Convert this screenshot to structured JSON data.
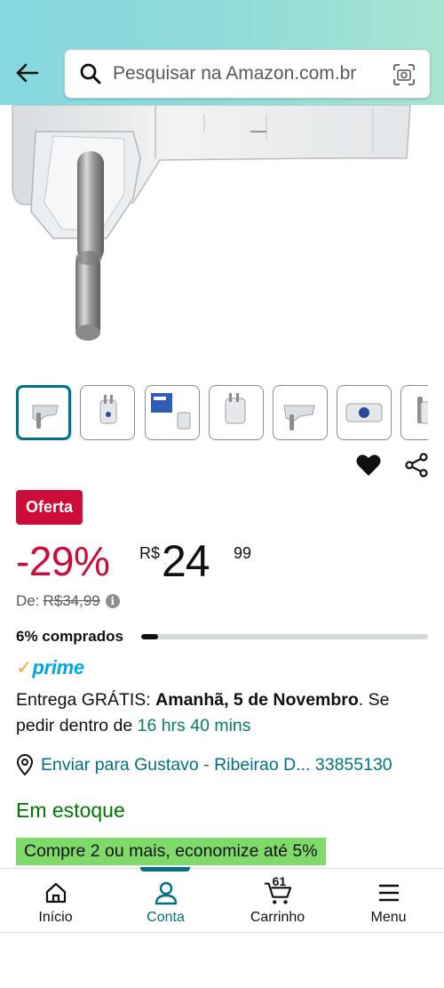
{
  "search": {
    "placeholder": "Pesquisar na Amazon.com.br"
  },
  "deal": {
    "badge": "Oferta"
  },
  "price": {
    "discount": "-29%",
    "currency": "R$",
    "whole": "24",
    "fraction": "99",
    "list_label": "De:",
    "list_value": "R$34,99"
  },
  "bought": {
    "label": "6% comprados",
    "fraction": 0.06
  },
  "prime": {
    "check": "✓",
    "label": "prime"
  },
  "delivery": {
    "prefix": "Entrega GRÁTIS: ",
    "date": "Amanhã, 5 de Novembro",
    "middle": ". Se pedir dentro de ",
    "countdown": "16 hrs 40 mins"
  },
  "ship_to": {
    "text": "Enviar para Gustavo - Ribeirao D... 33855130"
  },
  "stock": {
    "label": "Em estoque"
  },
  "promo": {
    "label": "Compre 2 ou mais, economize até 5%"
  },
  "nav": {
    "home": "Início",
    "account": "Conta",
    "cart": "Carrinho",
    "cart_count": "61",
    "menu": "Menu"
  },
  "colors": {
    "accent": "#007185",
    "deal_red": "#cc0c39",
    "prime_blue": "#00a8e1",
    "stock_green": "#007600",
    "promo_green": "#7fda69"
  },
  "icons": {
    "back": "arrow-left-icon",
    "search": "search-icon",
    "camera": "camera-scan-icon",
    "wishlist": "heart-icon",
    "share": "share-icon",
    "location": "location-pin-icon",
    "home": "home-icon",
    "account": "user-icon",
    "cart": "cart-icon",
    "menu": "hamburger-icon"
  }
}
